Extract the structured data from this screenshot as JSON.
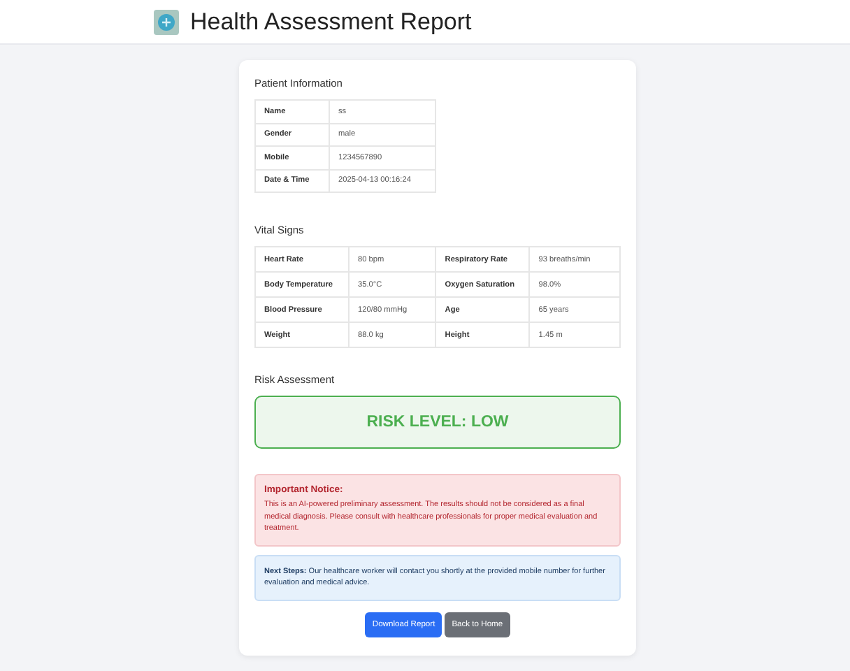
{
  "header": {
    "title": "Health Assessment Report"
  },
  "patient_information": {
    "heading": "Patient Information",
    "rows": [
      {
        "label": "Name",
        "value": "ss"
      },
      {
        "label": "Gender",
        "value": "male"
      },
      {
        "label": "Mobile",
        "value": "1234567890"
      },
      {
        "label": "Date & Time",
        "value": "2025-04-13 00:16:24"
      }
    ]
  },
  "vital_signs": {
    "heading": "Vital Signs",
    "rows": [
      [
        {
          "label": "Heart Rate",
          "value": "80 bpm"
        },
        {
          "label": "Respiratory Rate",
          "value": "93 breaths/min"
        }
      ],
      [
        {
          "label": "Body Temperature",
          "value": "35.0°C"
        },
        {
          "label": "Oxygen Saturation",
          "value": "98.0%"
        }
      ],
      [
        {
          "label": "Blood Pressure",
          "value": "120/80 mmHg"
        },
        {
          "label": "Age",
          "value": "65 years"
        }
      ],
      [
        {
          "label": "Weight",
          "value": "88.0 kg"
        },
        {
          "label": "Height",
          "value": "1.45 m"
        }
      ]
    ]
  },
  "risk_assessment": {
    "heading": "Risk Assessment",
    "result": "RISK LEVEL: LOW",
    "color": "#4caf50"
  },
  "notice": {
    "title": "Important Notice:",
    "text": "This is an AI-powered preliminary assessment. The results should not be considered as a final medical diagnosis. Please consult with healthcare professionals for proper medical evaluation and treatment."
  },
  "next_steps": {
    "text": "**Next Steps:** Our healthcare worker will contact you shortly at the provided mobile number for further evaluation and medical advice."
  },
  "buttons": [
    {
      "label": "Download Report",
      "kind": "primary"
    },
    {
      "label": "Back to Home",
      "kind": "secondary"
    }
  ]
}
